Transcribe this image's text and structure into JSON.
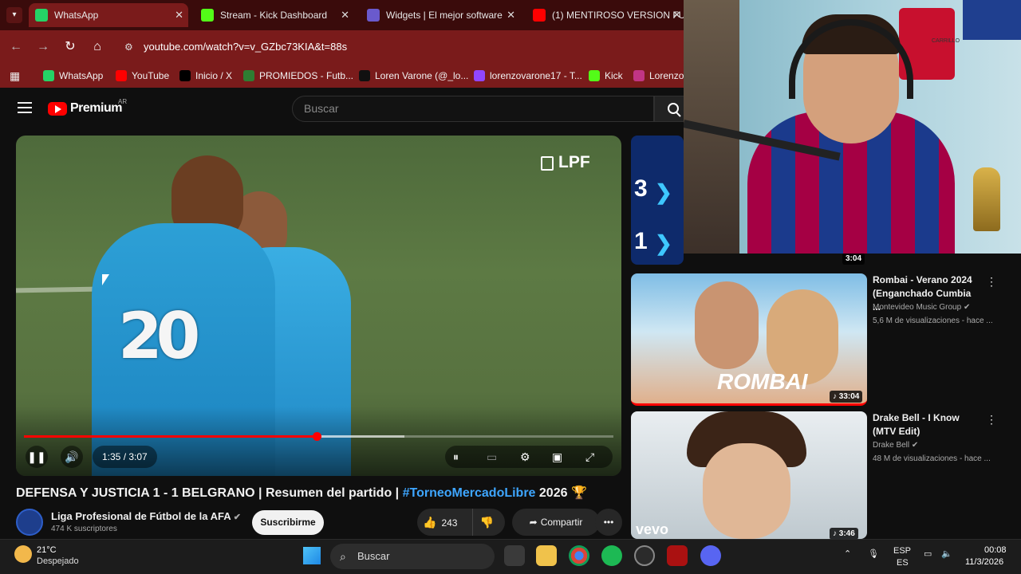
{
  "browser": {
    "tabs": [
      {
        "label": "WhatsApp",
        "color": "#25d366"
      },
      {
        "label": "Stream - Kick Dashboard",
        "color": "#53fc18"
      },
      {
        "label": "Widgets | El mejor software",
        "color": "#6a5acd"
      },
      {
        "label": "(1) MENTIROSO VERSION FU",
        "color": "#ff0000"
      }
    ],
    "close_glyph": "✕",
    "url": "youtube.com/watch?v=v_GZbc73KIA&t=88s",
    "bookmarks": [
      {
        "label": "WhatsApp",
        "color": "#25d366"
      },
      {
        "label": "YouTube",
        "color": "#ff0000"
      },
      {
        "label": "Inicio / X",
        "color": "#000000"
      },
      {
        "label": "PROMIEDOS - Futb...",
        "color": "#2e7d32"
      },
      {
        "label": "Loren Varone (@_lo...",
        "color": "#111111"
      },
      {
        "label": "lorenzovarone17 - T...",
        "color": "#9146ff"
      },
      {
        "label": "Kick",
        "color": "#53fc18"
      },
      {
        "label": "Lorenzo",
        "color": "#c13584"
      }
    ]
  },
  "youtube": {
    "brand": "Premium",
    "region": "AR",
    "search_placeholder": "Buscar",
    "player": {
      "overlay_logo": "LPF",
      "jersey_number": "20",
      "time": "1:35 / 3:07",
      "progress": 0.497,
      "buffered": 0.645
    },
    "video_title": "DEFENSA Y JUSTICIA 1 - 1 BELGRANO | Resumen del partido |",
    "video_hashtag": "#TorneoMercadoLibre",
    "video_title_year": "2026",
    "video_title_emoji": "🏆",
    "channel": {
      "name": "Liga Profesional de Fútbol de la AFA",
      "subs": "474 K suscriptores"
    },
    "subscribe": "Suscribirme",
    "likes": "243",
    "share": "Compartir",
    "more": "•••",
    "related": [
      {
        "title": "",
        "channel": "",
        "meta": "",
        "duration": "3:04",
        "score_a": "3",
        "score_b": "1"
      },
      {
        "title": "Rombai - Verano 2024 (Enganchado Cumbia ...",
        "channel": "Montevideo Music Group",
        "meta": "5,6 M de visualizaciones - hace ...",
        "duration": "33:04",
        "overlay": "ROMBAI"
      },
      {
        "title": "Drake Bell - I Know (MTV Edit)",
        "channel": "Drake Bell",
        "meta": "48 M de visualizaciones - hace ...",
        "duration": "3:46",
        "overlay": "vevo"
      }
    ]
  },
  "webcam": {
    "caption": "CARRILLO"
  },
  "taskbar": {
    "weather_temp": "21°C",
    "weather_desc": "Despejado",
    "search": "Buscar",
    "lang": "ESP",
    "lang_sub": "ES",
    "time": "00:08",
    "date": "11/3/2026"
  }
}
